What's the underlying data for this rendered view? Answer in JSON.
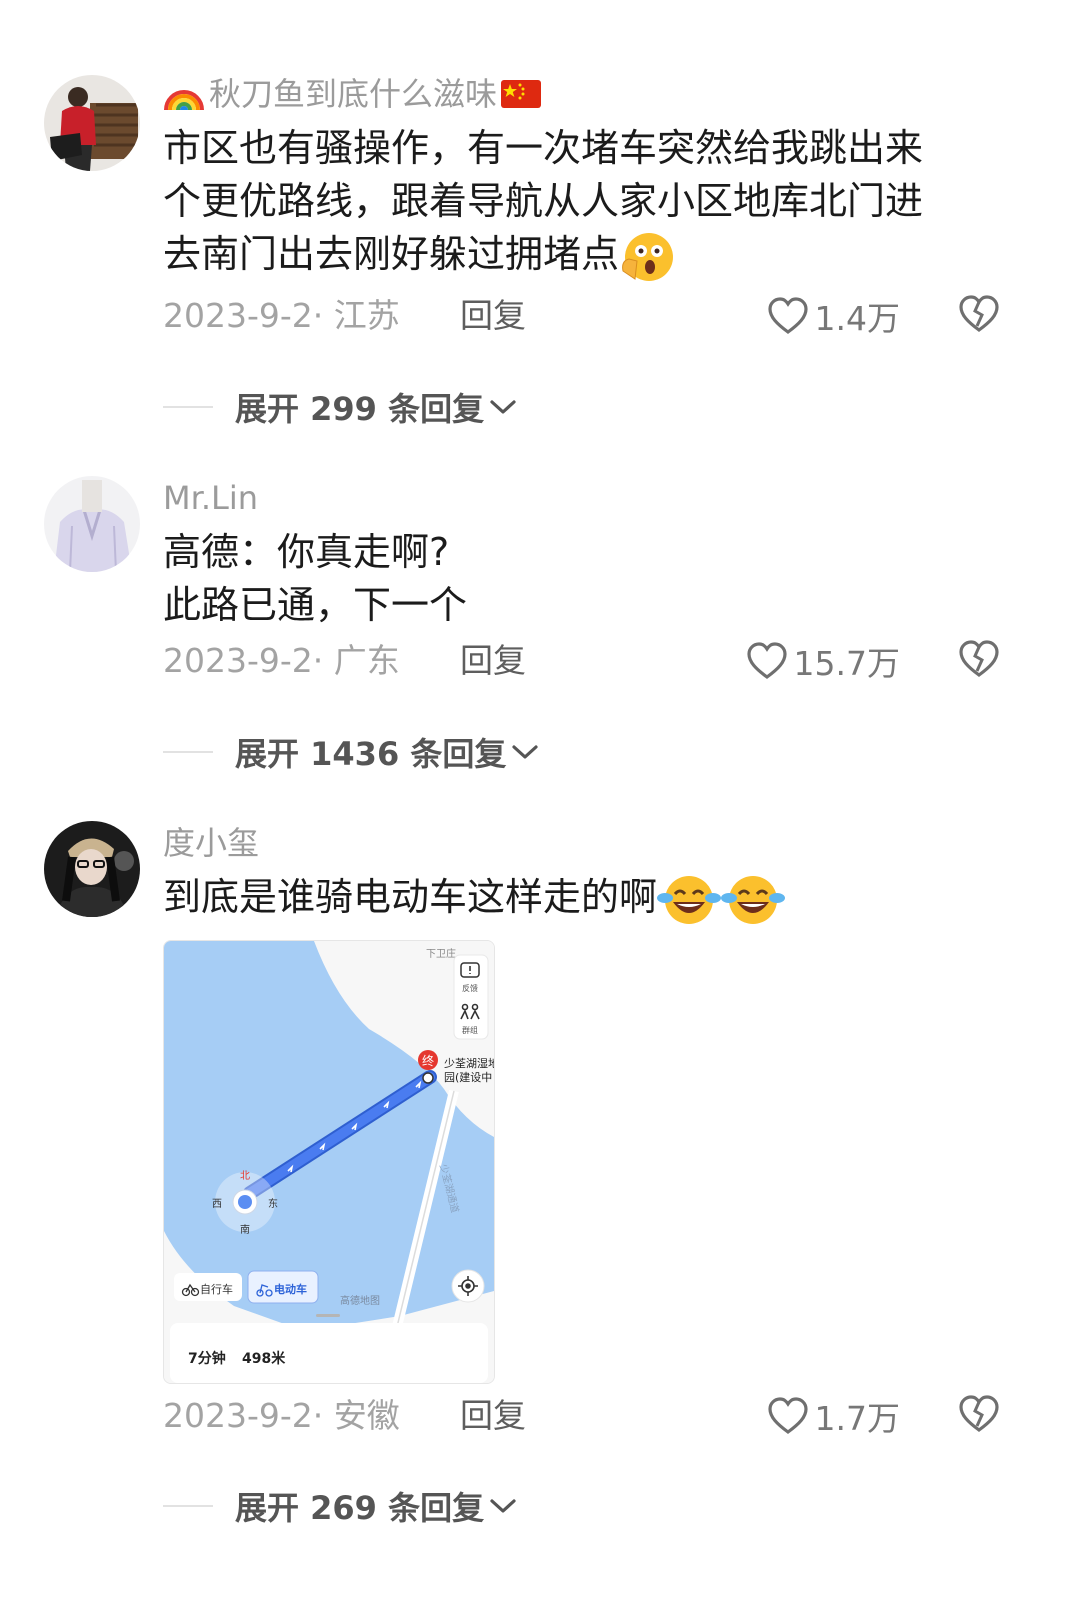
{
  "comments": [
    {
      "username": "秋刀鱼到底什么滋味",
      "lines": [
        "市区也有骚操作，有一次堵车突然给我跳出来",
        "个更优路线，跟着导航从人家小区地库北门进",
        "去南门出去刚好躲过拥堵点"
      ],
      "emoji": [
        "shocked-face-emoji"
      ],
      "date_location": "2023-9-2· 江苏",
      "reply_label": "回复",
      "likes": "1.4万",
      "expand_label": "展开 299 条回复"
    },
    {
      "username": "Mr.Lin",
      "lines": [
        "高德：你真走啊?",
        "此路已通，下一个"
      ],
      "date_location": "2023-9-2· 广东",
      "reply_label": "回复",
      "likes": "15.7万",
      "expand_label": "展开 1436 条回复"
    },
    {
      "username": "度小玺",
      "lines": [
        "到底是谁骑电动车这样走的啊"
      ],
      "emoji": [
        "crying-laughing-emoji",
        "crying-laughing-emoji"
      ],
      "date_location": "2023-9-2· 安徽",
      "reply_label": "回复",
      "likes": "1.7万",
      "expand_label": "展开 269 条回复"
    }
  ],
  "map_screenshot": {
    "top_label": "下卫庄",
    "feedback_label": "反馈",
    "group_label": "群组",
    "destination_marker": "终",
    "destination_name_1": "少荃湖湿地",
    "destination_name_2": "园(建设中",
    "road_label": "少荃湖通道",
    "compass_n": "北",
    "compass_w": "西",
    "compass_e": "东",
    "compass_s": "南",
    "mode_bike": "自行车",
    "mode_ebike": "电动车",
    "watermark": "高德地图",
    "duration": "7分钟",
    "distance": "498米"
  },
  "colors": {
    "water": "#a6cdf5",
    "route": "#3b6ee8",
    "accent_red": "#e5372f"
  }
}
